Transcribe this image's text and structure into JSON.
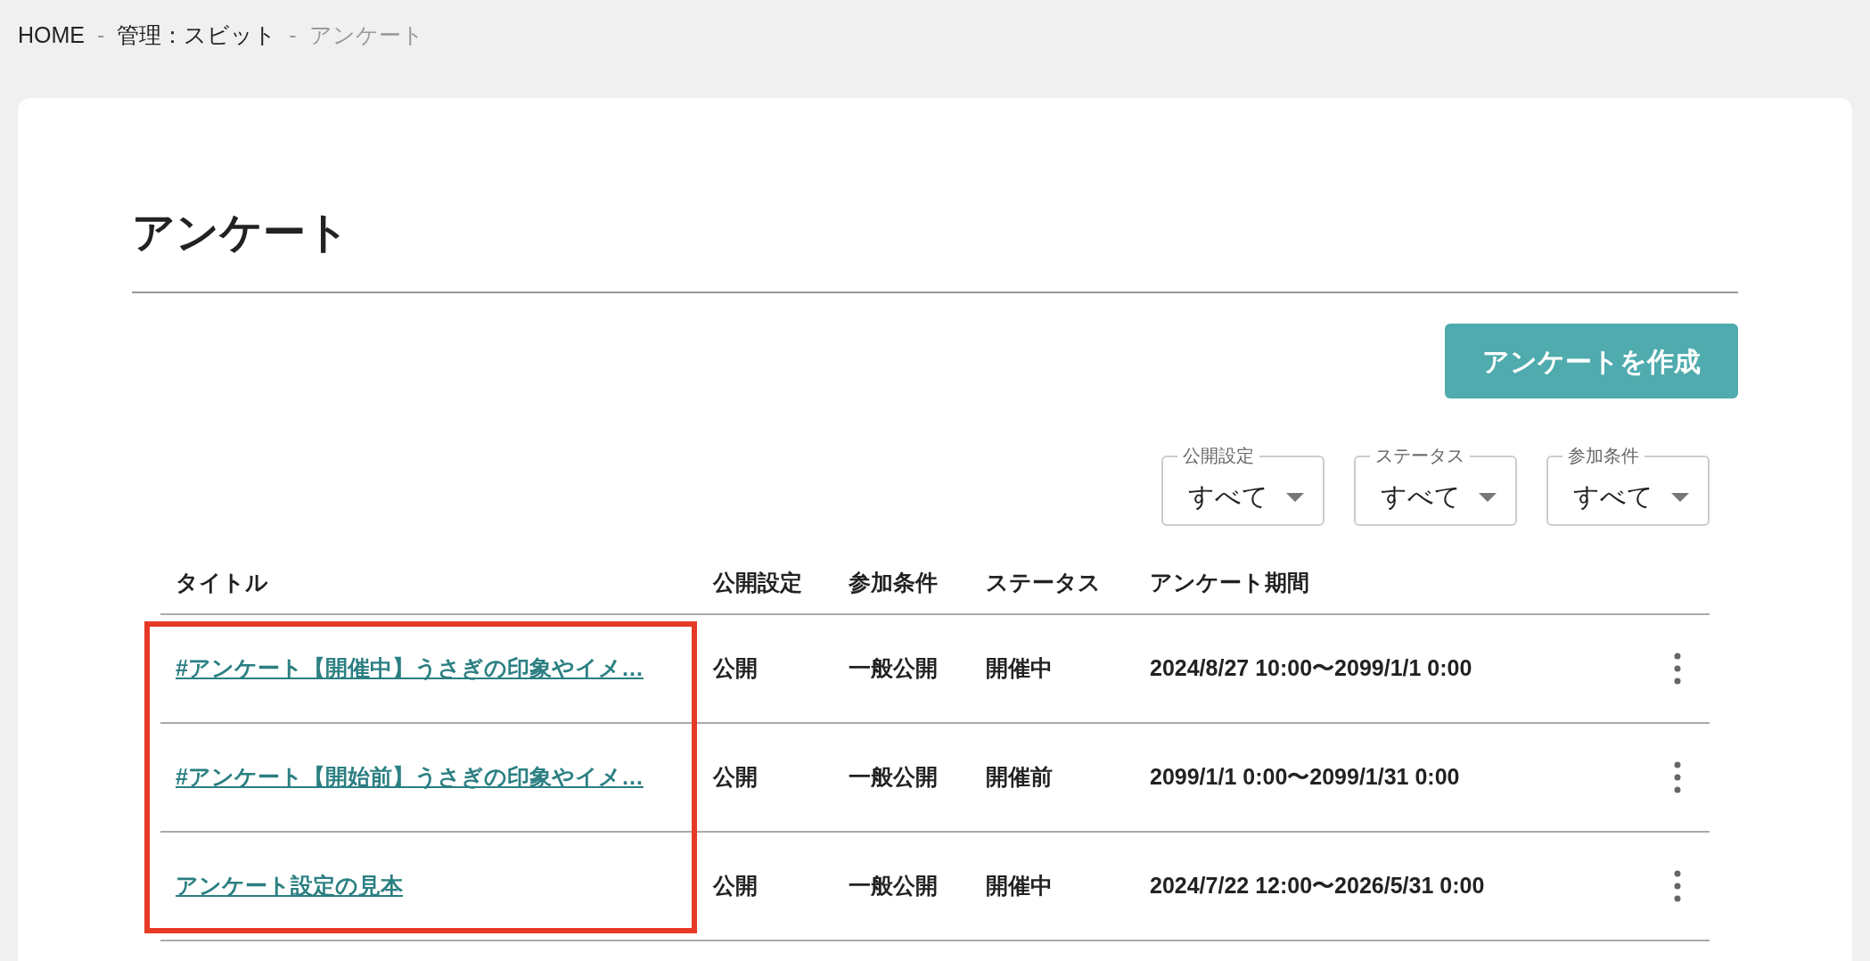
{
  "breadcrumb": [
    {
      "label": "HOME",
      "current": false
    },
    {
      "label": "管理：スビット",
      "current": false
    },
    {
      "label": "アンケート",
      "current": true
    }
  ],
  "breadcrumb_separator": "-",
  "page_title": "アンケート",
  "create_button": "アンケートを作成",
  "filters": [
    {
      "label": "公開設定",
      "value": "すべて"
    },
    {
      "label": "ステータス",
      "value": "すべて"
    },
    {
      "label": "参加条件",
      "value": "すべて"
    }
  ],
  "table": {
    "columns": [
      "タイトル",
      "公開設定",
      "参加条件",
      "ステータス",
      "アンケート期間"
    ],
    "rows": [
      {
        "title": "#アンケート【開催中】うさぎの印象やイメ…",
        "visibility": "公開",
        "condition": "一般公開",
        "status": "開催中",
        "period": "2024/8/27 10:00〜2099/1/1 0:00"
      },
      {
        "title": "#アンケート【開始前】うさぎの印象やイメ…",
        "visibility": "公開",
        "condition": "一般公開",
        "status": "開催前",
        "period": "2099/1/1 0:00〜2099/1/31 0:00"
      },
      {
        "title": "アンケート設定の見本",
        "visibility": "公開",
        "condition": "一般公開",
        "status": "開催中",
        "period": "2024/7/22 12:00〜2026/5/31 0:00"
      }
    ]
  }
}
